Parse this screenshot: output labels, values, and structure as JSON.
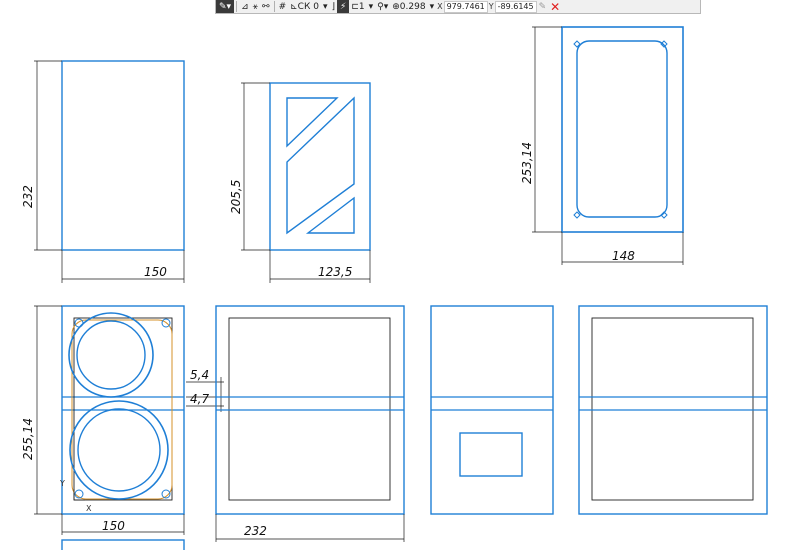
{
  "toolbar": {
    "layer_label": "СК 0",
    "step_value": "1",
    "zoom_value": "0.298",
    "x_label": "X",
    "x_value": "979.7461",
    "y_label": "Y",
    "y_value": "-89.6145"
  },
  "dimensions": {
    "front_height": "232",
    "front_width": "150",
    "side_height": "205,5",
    "side_width": "123,5",
    "panel_height": "253,14",
    "panel_width": "148",
    "baffle_height": "255,14",
    "baffle_width": "150",
    "gap_top": "5,4",
    "gap_bottom": "4,7",
    "long_width": "232",
    "axis_y": "Y",
    "axis_x": "X"
  },
  "colors": {
    "outline": "#1f7fd6",
    "dimension": "#1a1a1a",
    "inner": "#222222",
    "orange": "#d4902a"
  }
}
